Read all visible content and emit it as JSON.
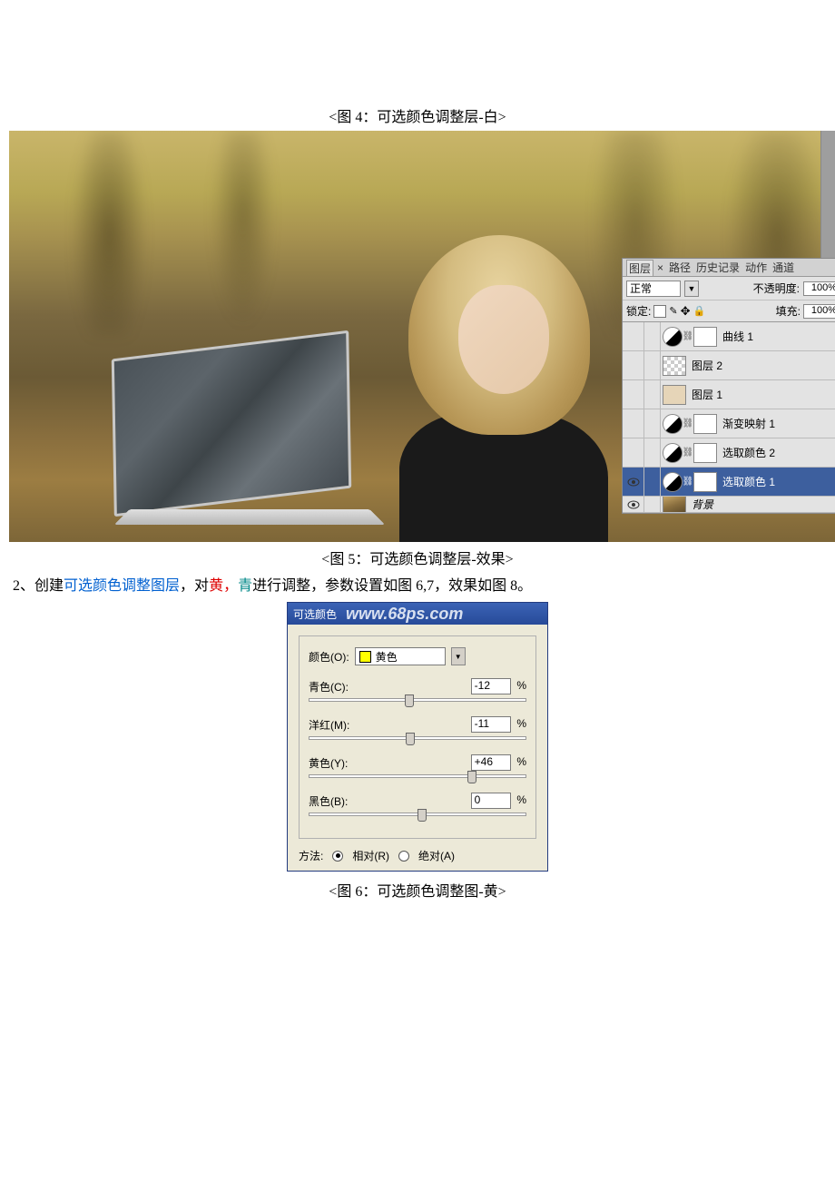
{
  "captions": {
    "fig4": "<图 4：可选颜色调整层-白>",
    "fig5": "<图 5：可选颜色调整层-效果>",
    "fig6": "<图 6：可选颜色调整图-黄>"
  },
  "watermark": "www.68ps.com",
  "panel": {
    "tabs": {
      "layers": "图层",
      "paths": "路径",
      "history": "历史记录",
      "actions": "动作",
      "channels": "通道"
    },
    "blend_mode": "正常",
    "opacity_label": "不透明度:",
    "opacity_value": "100%",
    "lock_label": "锁定:",
    "fill_label": "填充:",
    "fill_value": "100%",
    "layers": [
      {
        "name": "曲线 1",
        "type": "adj"
      },
      {
        "name": "图层 2",
        "type": "checker"
      },
      {
        "name": "图层 1",
        "type": "tan"
      },
      {
        "name": "渐变映射 1",
        "type": "grad"
      },
      {
        "name": "选取颜色 2",
        "type": "adj"
      },
      {
        "name": "选取颜色 1",
        "type": "adj",
        "selected": true,
        "eye": true
      },
      {
        "name": "背景",
        "type": "img",
        "eye": true
      }
    ]
  },
  "step": {
    "num": "2、",
    "pre": "创建",
    "link": "可选颜色调整图层",
    "mid1": "，对",
    "yellow": "黄，",
    "cyan": "青",
    "mid2": "进行调整，参数设置如图 6,7，效果如图 8。"
  },
  "dialog": {
    "title_prefix": "可选颜色",
    "color_label": "颜色(O):",
    "color_value": "黄色",
    "sliders": {
      "cyan": {
        "label": "青色(C):",
        "value": "-12",
        "pct": "%"
      },
      "magenta": {
        "label": "洋红(M):",
        "value": "-11",
        "pct": "%"
      },
      "yellow": {
        "label": "黄色(Y):",
        "value": "+46",
        "pct": "%"
      },
      "black": {
        "label": "黑色(B):",
        "value": "0",
        "pct": "%"
      }
    },
    "method_label": "方法:",
    "relative": "相对(R)",
    "absolute": "绝对(A)"
  }
}
